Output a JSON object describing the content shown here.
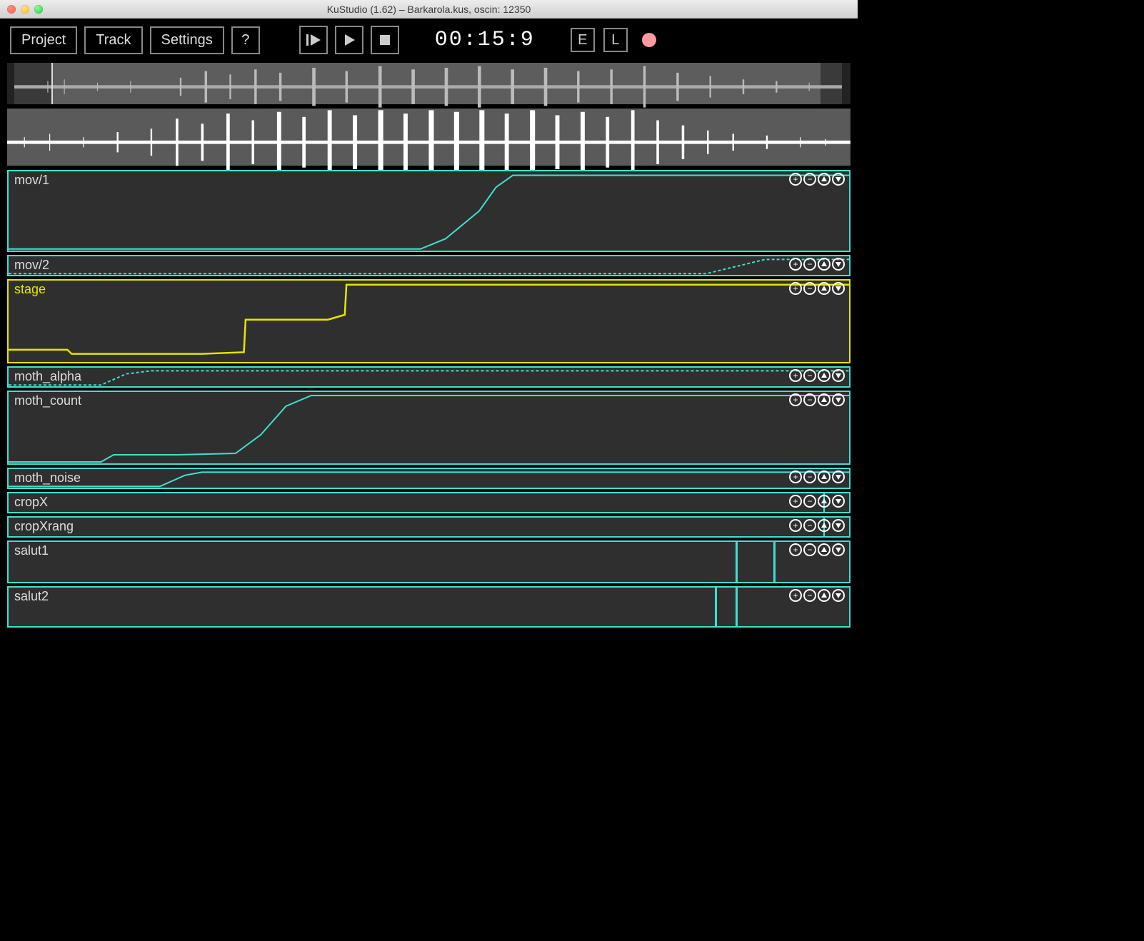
{
  "window": {
    "title": "KuStudio (1.62) – Barkarola.kus, oscin: 12350"
  },
  "toolbar": {
    "project_label": "Project",
    "track_label": "Track",
    "settings_label": "Settings",
    "help_label": "?",
    "timecode": "00:15:9",
    "e_label": "E",
    "l_label": "L"
  },
  "controls": {
    "plus": "+",
    "minus": "−",
    "up": "▲",
    "down": "▼"
  },
  "tracks": [
    {
      "name": "mov/1",
      "color": "cyan",
      "height": "h-big"
    },
    {
      "name": "mov/2",
      "color": "cyan",
      "height": "h-small"
    },
    {
      "name": "stage",
      "color": "yellow",
      "height": "h-stage"
    },
    {
      "name": "moth_alpha",
      "color": "cyan",
      "height": "h-small"
    },
    {
      "name": "moth_count",
      "color": "cyan",
      "height": "h-med"
    },
    {
      "name": "moth_noise",
      "color": "cyan",
      "height": "h-small"
    },
    {
      "name": "cropX",
      "color": "cyan",
      "height": "h-small"
    },
    {
      "name": "cropXrang",
      "color": "cyan",
      "height": "h-small"
    },
    {
      "name": "salut1",
      "color": "cyan",
      "height": "h-salut"
    },
    {
      "name": "salut2",
      "color": "cyan",
      "height": "h-salut2"
    }
  ]
}
